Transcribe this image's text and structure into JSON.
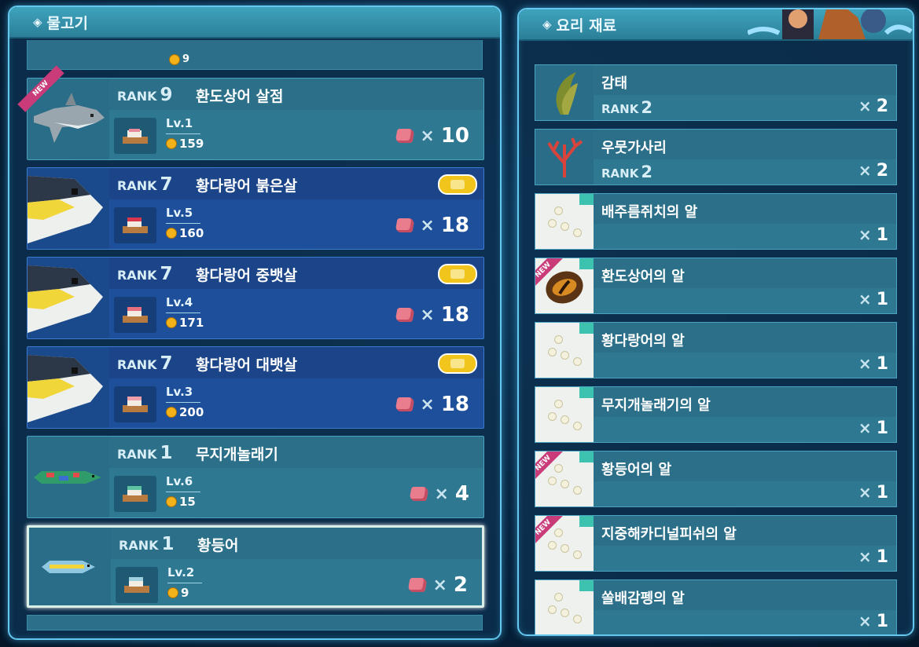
{
  "fish_panel": {
    "title": "물고기",
    "partial_top_price": "9",
    "rows": [
      {
        "rank_label": "RANK",
        "rank": "9",
        "name": "환도상어 살점",
        "level": "Lv.1",
        "price": "159",
        "times": "×",
        "qty": "10",
        "is_new": true,
        "new_label": "NEW",
        "highlight": false,
        "sub_icon": false,
        "fish_icon": "thresher-shark-icon"
      },
      {
        "rank_label": "RANK",
        "rank": "7",
        "name": "황다랑어 붉은살",
        "level": "Lv.5",
        "price": "160",
        "times": "×",
        "qty": "18",
        "is_new": false,
        "highlight": true,
        "sub_icon": true,
        "fish_icon": "yellowfin-tuna-icon"
      },
      {
        "rank_label": "RANK",
        "rank": "7",
        "name": "황다랑어 중뱃살",
        "level": "Lv.4",
        "price": "171",
        "times": "×",
        "qty": "18",
        "is_new": false,
        "highlight": true,
        "sub_icon": true,
        "fish_icon": "yellowfin-tuna-icon"
      },
      {
        "rank_label": "RANK",
        "rank": "7",
        "name": "황다랑어 대뱃살",
        "level": "Lv.3",
        "price": "200",
        "times": "×",
        "qty": "18",
        "is_new": false,
        "highlight": true,
        "sub_icon": true,
        "fish_icon": "yellowfin-tuna-icon"
      },
      {
        "rank_label": "RANK",
        "rank": "1",
        "name": "무지개놀래기",
        "level": "Lv.6",
        "price": "15",
        "times": "×",
        "qty": "4",
        "is_new": false,
        "highlight": false,
        "sub_icon": false,
        "fish_icon": "rainbow-wrasse-icon"
      },
      {
        "rank_label": "RANK",
        "rank": "1",
        "name": "황등어",
        "level": "Lv.2",
        "price": "9",
        "times": "×",
        "qty": "2",
        "is_new": false,
        "highlight": false,
        "sub_icon": false,
        "selected": true,
        "fish_icon": "yellow-fish-icon"
      }
    ]
  },
  "ingredient_panel": {
    "title": "요리 재료",
    "rows": [
      {
        "name": "감태",
        "rank_label": "RANK",
        "rank": "2",
        "times": "×",
        "qty": "2",
        "icon": "seaweed-icon",
        "is_new": false
      },
      {
        "name": "우뭇가사리",
        "rank_label": "RANK",
        "rank": "2",
        "times": "×",
        "qty": "2",
        "icon": "red-algae-icon",
        "is_new": false
      },
      {
        "name": "배주름쥐치의 알",
        "times": "×",
        "qty": "1",
        "icon": "eggs-icon",
        "is_new": false
      },
      {
        "name": "환도상어의 알",
        "times": "×",
        "qty": "1",
        "icon": "shark-egg-icon",
        "is_new": true
      },
      {
        "name": "황다랑어의 알",
        "times": "×",
        "qty": "1",
        "icon": "eggs-icon",
        "is_new": false
      },
      {
        "name": "무지개놀래기의 알",
        "times": "×",
        "qty": "1",
        "icon": "eggs-icon",
        "is_new": false
      },
      {
        "name": "황등어의 알",
        "times": "×",
        "qty": "1",
        "icon": "eggs-icon",
        "is_new": true
      },
      {
        "name": "지중해카디널피쉬의 알",
        "times": "×",
        "qty": "1",
        "icon": "eggs-icon",
        "is_new": true
      },
      {
        "name": "쏠배감펭의 알",
        "times": "×",
        "qty": "1",
        "icon": "eggs-icon",
        "is_new": false
      }
    ]
  },
  "header_symbol": "◈",
  "colors": {
    "accent": "#63c7ee",
    "row": "#2e7892",
    "highlight_row": "#1d4f9a",
    "coin": "#f3b21a",
    "new": "#c93b79"
  }
}
